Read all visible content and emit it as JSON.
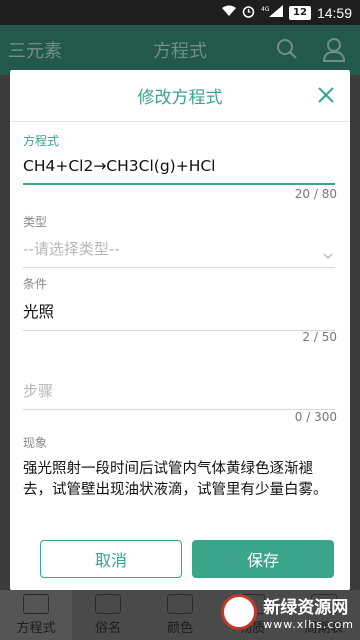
{
  "status_bar": {
    "battery": "12",
    "time": "14:59",
    "network": "4G"
  },
  "appbar": {
    "menu_label": "三元素",
    "title": "方程式"
  },
  "tabs": [
    {
      "label": "方程式"
    },
    {
      "label": "俗名"
    },
    {
      "label": "颜色"
    },
    {
      "label": "物质"
    },
    {
      "label": "周期表"
    }
  ],
  "watermark": {
    "cn": "新绿资源网",
    "url": "www.xlhs.com"
  },
  "dialog": {
    "title": "修改方程式",
    "equation": {
      "label": "方程式",
      "value": "CH4+Cl2→CH3Cl(g)+HCl",
      "counter": "20 / 80"
    },
    "type": {
      "label": "类型",
      "placeholder": "--请选择类型--"
    },
    "condition": {
      "label": "条件",
      "value": "光照",
      "counter": "2 / 50"
    },
    "steps": {
      "placeholder": "步骤",
      "counter": "0 / 300"
    },
    "phenomenon": {
      "label": "现象",
      "value": "强光照射一段时间后试管内气体黄绿色逐渐褪去，试管壁出现油状液滴，试管里有少量白雾。"
    },
    "cancel_label": "取消",
    "save_label": "保存"
  },
  "colors": {
    "accent": "#3aa58a",
    "appbar": "#23594a"
  }
}
